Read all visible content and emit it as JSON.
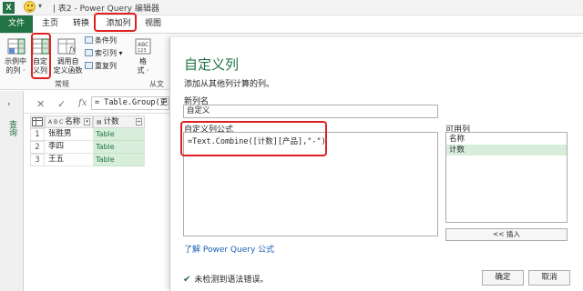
{
  "titlebar": {
    "logo": "X",
    "dropdown": "▾",
    "title": "| 表2 - Power Query 编辑器"
  },
  "tabs": [
    "文件",
    "主页",
    "转换",
    "添加列",
    "视图"
  ],
  "ribbon": {
    "example_label": "示例中\n的列 ·",
    "custom_label": "自定\n义列",
    "invoke_label": "调用自\n定义函数",
    "cond_col": "条件列",
    "index_col": "索引列 ▾",
    "dup_col": "重复列",
    "format": "格\n式 ·",
    "group_general": "常规",
    "group_fromtext": "从文"
  },
  "formula_bar": {
    "cancel": "✕",
    "confirm": "✓",
    "fx": "fx",
    "value": "= Table.Group(更改"
  },
  "query_pane": {
    "chevron": "›",
    "label": "查询"
  },
  "grid": {
    "col_name_type": "A B C",
    "col_name": "名称",
    "col_count_type": "▤",
    "col_count": "计数",
    "rows": [
      {
        "n": "1",
        "name": "张胜男",
        "value": "Table"
      },
      {
        "n": "2",
        "name": "李四",
        "value": "Table"
      },
      {
        "n": "3",
        "name": "王五",
        "value": "Table"
      }
    ]
  },
  "dialog": {
    "title": "自定义列",
    "description": "添加从其他列计算的列。",
    "new_col_label": "新列名",
    "new_col_value": "自定义",
    "formula_label": "自定义列公式",
    "formula": "=Text.Combine([计数][产品],\"-\")",
    "learn_link": "了解 Power Query 公式",
    "available_label": "可用列",
    "available_cols": [
      "名称",
      "计数"
    ],
    "insert_button": "<< 插入",
    "status": "未检测到语法错误。",
    "ok_button": "确定",
    "cancel_button": "取消"
  },
  "colors": {
    "accent": "#217346",
    "highlight": "#e02020",
    "selected_bg": "#d8eedb"
  }
}
